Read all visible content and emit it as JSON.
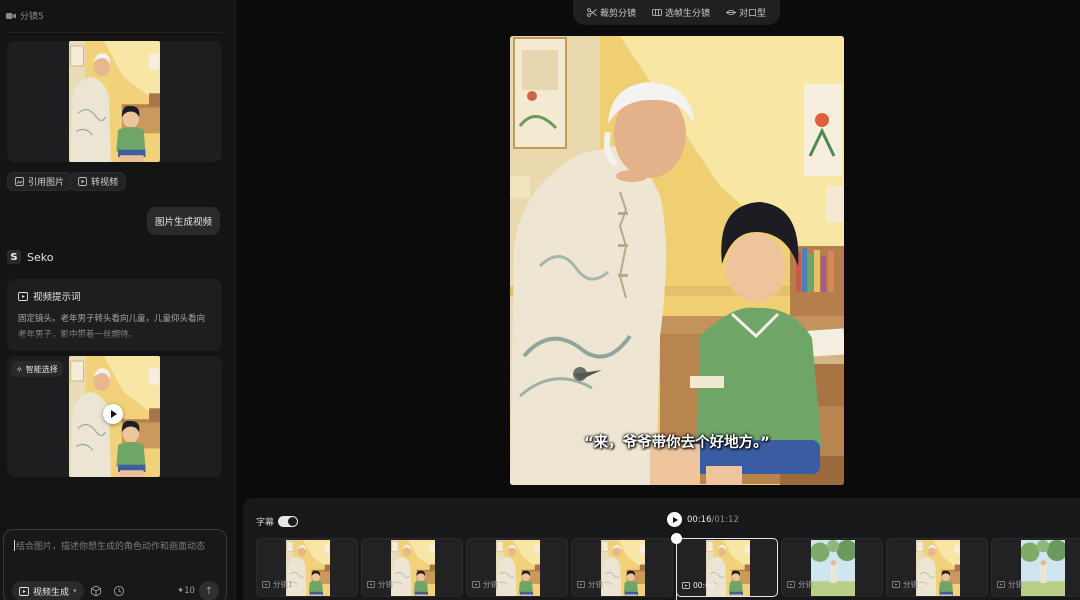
{
  "left_panel": {
    "header_label": "分镜5",
    "reference_buttons": {
      "quote_image": "引用图片",
      "to_video": "转视频"
    },
    "user_message": "图片生成视频",
    "assistant_name": "Seko",
    "prompt_card": {
      "title": "视频提示词",
      "text": "固定镜头。老年男子转头看向儿童，儿童仰头看向老年男子，影中带着一丝期待。"
    },
    "smart_badge": "智能选择",
    "input": {
      "placeholder": "结合图片，描述你想生成的角色动作和画面动态",
      "mode_label": "视频生成",
      "credits": "10"
    }
  },
  "toolbar": {
    "items": [
      "裁剪分镜",
      "选帧生分镜",
      "对口型"
    ]
  },
  "preview": {
    "subtitle": "“来，爷爷带你去个好地方。”"
  },
  "timeline": {
    "subtitle_toggle_label": "字幕",
    "subtitle_toggle_on": true,
    "current_time": "00:16",
    "separator": "/",
    "total_time": "01:12",
    "clips": [
      {
        "label": "分镜1",
        "active": false
      },
      {
        "label": "分镜",
        "active": false
      },
      {
        "label": "分镜",
        "active": false
      },
      {
        "label": "分镜",
        "active": false
      },
      {
        "label": "00:05",
        "active": true
      },
      {
        "label": "分镜",
        "active": false
      },
      {
        "label": "分镜",
        "active": false
      },
      {
        "label": "分镜",
        "active": false
      }
    ]
  },
  "colors": {
    "background": "#0b0b0c",
    "panel": "#141415",
    "card": "#1e1e20",
    "wall_yellow": "#f2d47a",
    "shirt_green": "#6fa567"
  }
}
